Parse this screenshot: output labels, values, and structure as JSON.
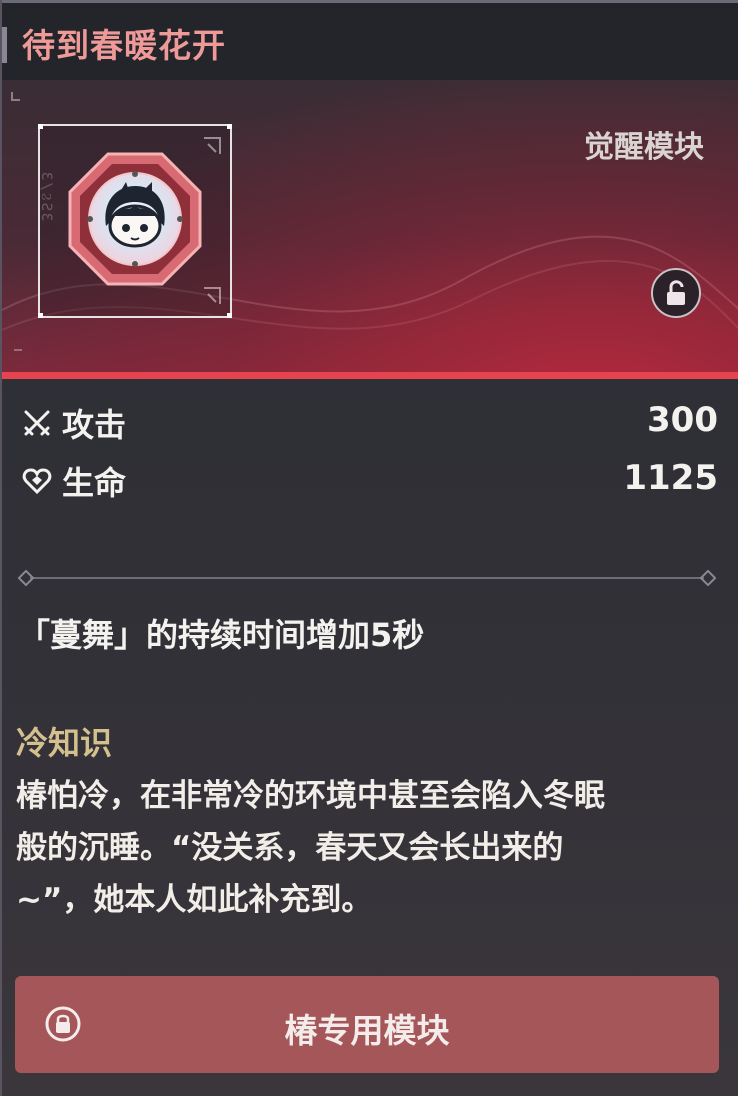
{
  "header": {
    "title": "待到春暖花开"
  },
  "module": {
    "type_label": "觉醒模块",
    "side_code": "Ɛ\\ϨƧƐ",
    "icon": "chibi-character-icon",
    "lock_icon": "unlock-icon"
  },
  "stats": [
    {
      "icon": "crossed-swords-icon",
      "label": "攻击",
      "value": "300"
    },
    {
      "icon": "heart-icon",
      "label": "生命",
      "value": "1125"
    }
  ],
  "effect": "「蔓舞」的持续时间增加5秒",
  "lore": {
    "title": "冷知识",
    "lines": [
      "椿怕冷，在非常冷的环境中甚至会陷入冬眠",
      "般的沉睡。“没关系，春天又会长出来的",
      "~”，她本人如此补充到。"
    ]
  },
  "exclusive": {
    "icon": "lock-icon",
    "label": "椿专用模块"
  },
  "colors": {
    "title": "#ee9a98",
    "accent_line": "#e5444f",
    "lore_title": "#d4c08e",
    "exclusive_button": "#a55658"
  }
}
